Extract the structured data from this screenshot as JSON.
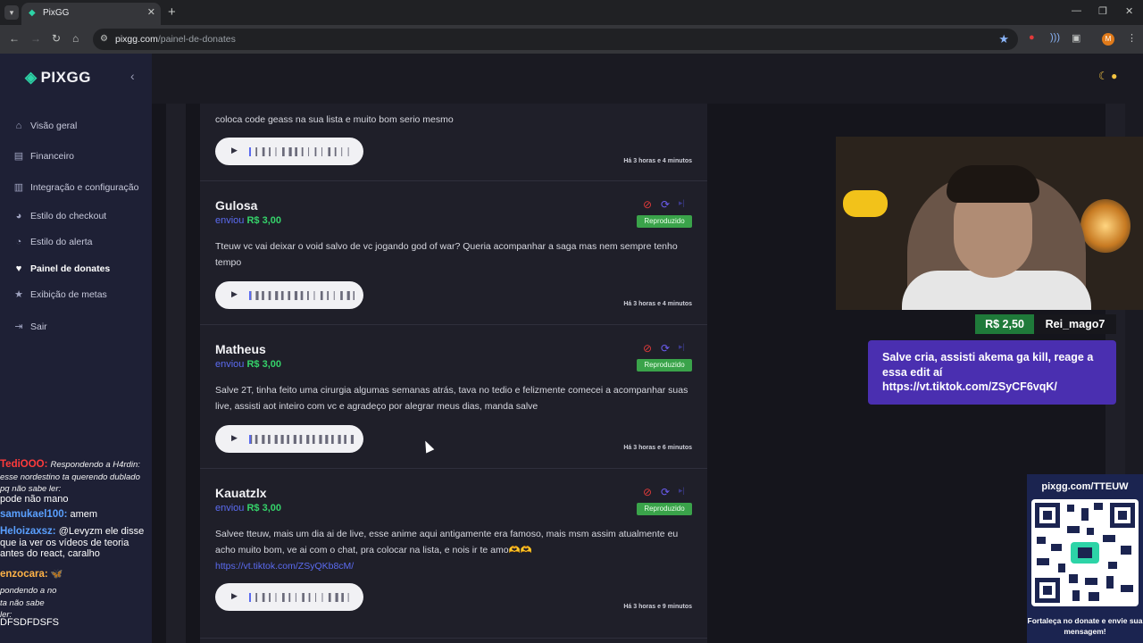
{
  "browser": {
    "tab_title": "PixGG",
    "url_domain": "pixgg.com",
    "url_path": "/painel-de-donates",
    "profile_initial": "M"
  },
  "sidebar": {
    "brand": "PIXGG",
    "items": [
      {
        "label": "Visão geral",
        "icon": "home-icon"
      },
      {
        "label": "Financeiro",
        "icon": "wallet-icon"
      },
      {
        "label": "Integração e configuração",
        "icon": "settings-icon"
      },
      {
        "label": "Estilo do checkout",
        "icon": "palette-icon"
      },
      {
        "label": "Estilo do alerta",
        "icon": "alert-style-icon"
      },
      {
        "label": "Painel de donates",
        "icon": "donate-icon",
        "active": true
      },
      {
        "label": "Exibição de metas",
        "icon": "star-icon"
      },
      {
        "label": "Sair",
        "icon": "logout-icon"
      }
    ]
  },
  "donations": [
    {
      "name": "",
      "sent_label": "",
      "amount": "",
      "message": "coloca code geass na sua lista e muito bom serio mesmo",
      "link": "",
      "time": "Há 3 horas e 4 minutos",
      "status": ""
    },
    {
      "name": "Gulosa",
      "sent_label": "enviou",
      "amount": "R$ 3,00",
      "message": "Tteuw vc vai deixar o void salvo de vc jogando god of war? Queria acompanhar a saga mas nem sempre tenho tempo",
      "link": "",
      "time": "Há 3 horas e 4 minutos",
      "status": "Reproduzido"
    },
    {
      "name": "Matheus",
      "sent_label": "enviou",
      "amount": "R$ 3,00",
      "message": "Salve 2T, tinha feito uma cirurgia algumas semanas atrás, tava no tedio e felizmente comecei a acompanhar suas live, assisti aot inteiro com vc e agradeço por alegrar meus dias, manda salve",
      "link": "",
      "time": "Há 3 horas e 6 minutos",
      "status": "Reproduzido"
    },
    {
      "name": "Kauatzlx",
      "sent_label": "enviou",
      "amount": "R$ 3,00",
      "message": "Salvee tteuw, mais um dia ai de live, esse anime aqui antigamente era famoso, mais msm assim atualmente eu acho muito bom, ve ai com o chat, pra colocar na lista, e nois ir te amo🫶🫶",
      "link": "https://vt.tiktok.com/ZSyQKb8cM/",
      "time": "Há 3 horas e 9 minutos",
      "status": "Reproduzido"
    }
  ],
  "overlay_alert": {
    "amount": "R$ 2,50",
    "name": "Rei_mago7",
    "message": "Salve cria, assisti akema ga kill, reage a essa edit aí https://vt.tiktok.com/ZSyCF6vqK/"
  },
  "overlay_qr": {
    "url": "pixgg.com/TTEUW",
    "cta": "Fortaleça no donate e envie sua mensagem!"
  },
  "chat": [
    {
      "user": "TediOOO:",
      "color": "#ff3b3b",
      "text": "Respondendo a H4rdin: esse nordestino ta querendo dublado pq não sabe ler:",
      "reply": true
    },
    {
      "user": "",
      "color": "#ffffff",
      "text": "pode não mano",
      "reply": false
    },
    {
      "user": "samukael100:",
      "color": "#5aa0ff",
      "text": "amem",
      "reply": false
    },
    {
      "user": "Heloizaxsz:",
      "color": "#5aa0ff",
      "text": "@Levyzm ele disse que ia ver os vídeos de teoria antes do react, caralho",
      "reply": false
    },
    {
      "user": "enzocara:",
      "color": "#ffb347",
      "text": "🦋",
      "reply": false
    },
    {
      "user": "",
      "color": "#ffffff",
      "text": "pondendo a no ta não sabe ler:",
      "reply": true
    },
    {
      "user": "",
      "color": "#ffffff",
      "text": "DFSDFDSFS",
      "reply": false
    }
  ],
  "colors": {
    "accent": "#5b6bf0",
    "money": "#35d36a",
    "status_badge": "#3aa34a",
    "sidebar_bg": "#1e2035"
  }
}
